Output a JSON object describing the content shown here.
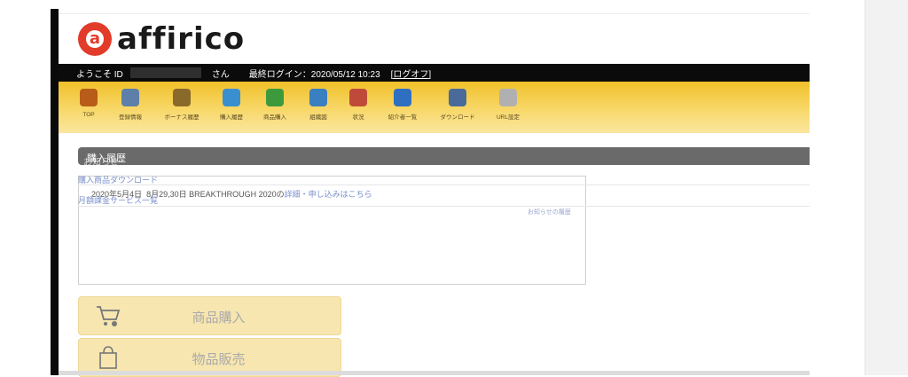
{
  "brand": {
    "mark": "a",
    "name": "affirico"
  },
  "status": {
    "welcome": "ようこそ ID",
    "suffix": "さん",
    "last_login": "最終ログイン：2020/05/12 10:23",
    "logout": "[ログオフ]"
  },
  "nav": {
    "items": [
      {
        "label": "TOP",
        "icon": "home-icon",
        "color": "#b85c1a"
      },
      {
        "label": "登録情報",
        "icon": "book-icon",
        "color": "#5d7fa8"
      },
      {
        "label": "ボーナス履歴",
        "icon": "money-bag-icon",
        "color": "#8a6a2a"
      },
      {
        "label": "購入履歴",
        "icon": "card-icon",
        "color": "#3a8fd0"
      },
      {
        "label": "商品購入",
        "icon": "cart-icon",
        "color": "#3c9a3c"
      },
      {
        "label": "組織図",
        "icon": "org-chart-icon",
        "color": "#3a7fc0"
      },
      {
        "label": "状況",
        "icon": "chart-icon",
        "color": "#c04a3a"
      },
      {
        "label": "紹介者一覧",
        "icon": "users-icon",
        "color": "#2f6fc0"
      },
      {
        "label": "ダウンロード",
        "icon": "download-icon",
        "color": "#4a6a9a"
      },
      {
        "label": "URL設定",
        "icon": "mail-icon",
        "color": "#9a9a9a"
      }
    ]
  },
  "section": {
    "title": "購入履歴",
    "overlay_title": "お知らせ"
  },
  "links": {
    "download": "購入商品ダウンロード",
    "service": "月額課金サービス一覧",
    "history": "お知らせの履歴"
  },
  "news": {
    "date": "2020年5月4日",
    "text": "8月29,30日 BREAKTHROUGH 2020の",
    "link": "詳細・申し込みはこちら"
  },
  "actions": [
    {
      "label": "商品購入",
      "icon": "cart-icon"
    },
    {
      "label": "物品販売",
      "icon": "shopping-bag-icon"
    }
  ]
}
